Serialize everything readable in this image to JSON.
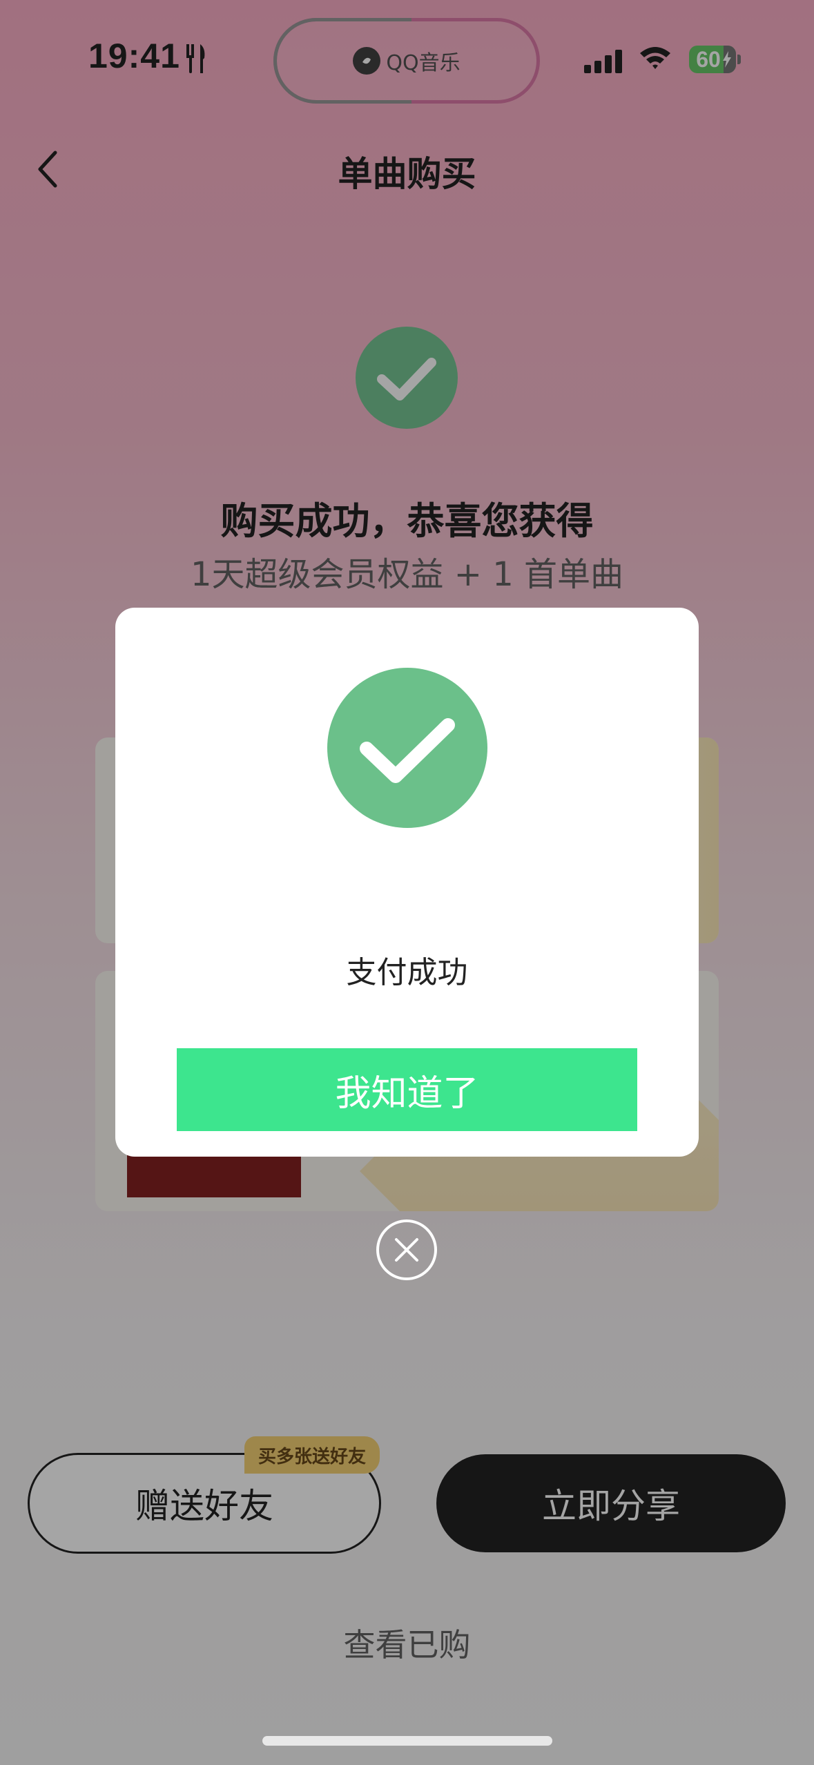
{
  "status_bar": {
    "time": "19:41",
    "battery": "60",
    "dynamic_island_app": "QQ音乐"
  },
  "header": {
    "title": "单曲购买"
  },
  "success": {
    "heading": "购买成功，恭喜您获得",
    "subtext": "1天超级会员权益 + 1 首单曲"
  },
  "dialog": {
    "message": "支付成功",
    "ok_label": "我知道了"
  },
  "actions": {
    "gift_label": "赠送好友",
    "gift_tag": "买多张送好友",
    "share_label": "立即分享",
    "view_purchased": "查看已购"
  },
  "colors": {
    "accent_green": "#3de58e",
    "check_green": "#6bc08a",
    "header_gradient_top": "#f9a7c1"
  }
}
